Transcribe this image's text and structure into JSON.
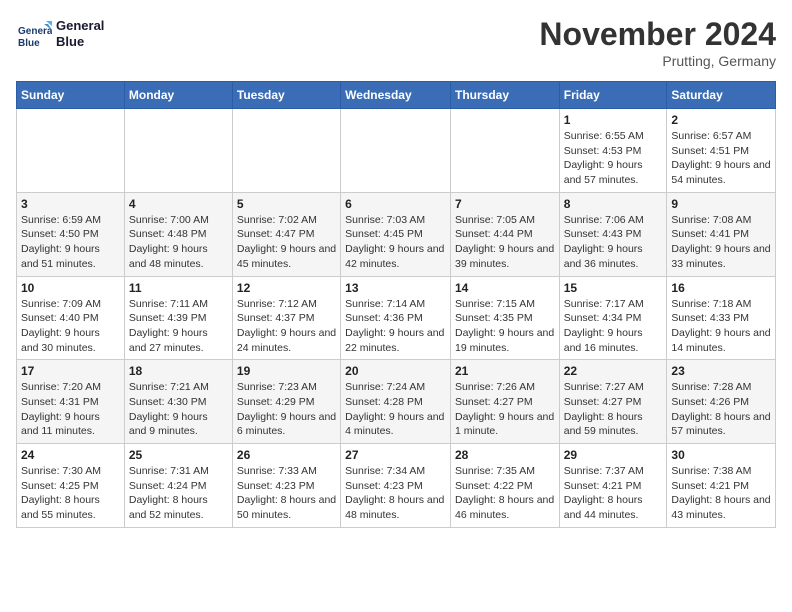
{
  "header": {
    "logo_line1": "General",
    "logo_line2": "Blue",
    "title": "November 2024",
    "subtitle": "Prutting, Germany"
  },
  "columns": [
    "Sunday",
    "Monday",
    "Tuesday",
    "Wednesday",
    "Thursday",
    "Friday",
    "Saturday"
  ],
  "weeks": [
    {
      "days": [
        {
          "num": "",
          "info": ""
        },
        {
          "num": "",
          "info": ""
        },
        {
          "num": "",
          "info": ""
        },
        {
          "num": "",
          "info": ""
        },
        {
          "num": "",
          "info": ""
        },
        {
          "num": "1",
          "info": "Sunrise: 6:55 AM\nSunset: 4:53 PM\nDaylight: 9 hours and 57 minutes."
        },
        {
          "num": "2",
          "info": "Sunrise: 6:57 AM\nSunset: 4:51 PM\nDaylight: 9 hours and 54 minutes."
        }
      ]
    },
    {
      "days": [
        {
          "num": "3",
          "info": "Sunrise: 6:59 AM\nSunset: 4:50 PM\nDaylight: 9 hours and 51 minutes."
        },
        {
          "num": "4",
          "info": "Sunrise: 7:00 AM\nSunset: 4:48 PM\nDaylight: 9 hours and 48 minutes."
        },
        {
          "num": "5",
          "info": "Sunrise: 7:02 AM\nSunset: 4:47 PM\nDaylight: 9 hours and 45 minutes."
        },
        {
          "num": "6",
          "info": "Sunrise: 7:03 AM\nSunset: 4:45 PM\nDaylight: 9 hours and 42 minutes."
        },
        {
          "num": "7",
          "info": "Sunrise: 7:05 AM\nSunset: 4:44 PM\nDaylight: 9 hours and 39 minutes."
        },
        {
          "num": "8",
          "info": "Sunrise: 7:06 AM\nSunset: 4:43 PM\nDaylight: 9 hours and 36 minutes."
        },
        {
          "num": "9",
          "info": "Sunrise: 7:08 AM\nSunset: 4:41 PM\nDaylight: 9 hours and 33 minutes."
        }
      ]
    },
    {
      "days": [
        {
          "num": "10",
          "info": "Sunrise: 7:09 AM\nSunset: 4:40 PM\nDaylight: 9 hours and 30 minutes."
        },
        {
          "num": "11",
          "info": "Sunrise: 7:11 AM\nSunset: 4:39 PM\nDaylight: 9 hours and 27 minutes."
        },
        {
          "num": "12",
          "info": "Sunrise: 7:12 AM\nSunset: 4:37 PM\nDaylight: 9 hours and 24 minutes."
        },
        {
          "num": "13",
          "info": "Sunrise: 7:14 AM\nSunset: 4:36 PM\nDaylight: 9 hours and 22 minutes."
        },
        {
          "num": "14",
          "info": "Sunrise: 7:15 AM\nSunset: 4:35 PM\nDaylight: 9 hours and 19 minutes."
        },
        {
          "num": "15",
          "info": "Sunrise: 7:17 AM\nSunset: 4:34 PM\nDaylight: 9 hours and 16 minutes."
        },
        {
          "num": "16",
          "info": "Sunrise: 7:18 AM\nSunset: 4:33 PM\nDaylight: 9 hours and 14 minutes."
        }
      ]
    },
    {
      "days": [
        {
          "num": "17",
          "info": "Sunrise: 7:20 AM\nSunset: 4:31 PM\nDaylight: 9 hours and 11 minutes."
        },
        {
          "num": "18",
          "info": "Sunrise: 7:21 AM\nSunset: 4:30 PM\nDaylight: 9 hours and 9 minutes."
        },
        {
          "num": "19",
          "info": "Sunrise: 7:23 AM\nSunset: 4:29 PM\nDaylight: 9 hours and 6 minutes."
        },
        {
          "num": "20",
          "info": "Sunrise: 7:24 AM\nSunset: 4:28 PM\nDaylight: 9 hours and 4 minutes."
        },
        {
          "num": "21",
          "info": "Sunrise: 7:26 AM\nSunset: 4:27 PM\nDaylight: 9 hours and 1 minute."
        },
        {
          "num": "22",
          "info": "Sunrise: 7:27 AM\nSunset: 4:27 PM\nDaylight: 8 hours and 59 minutes."
        },
        {
          "num": "23",
          "info": "Sunrise: 7:28 AM\nSunset: 4:26 PM\nDaylight: 8 hours and 57 minutes."
        }
      ]
    },
    {
      "days": [
        {
          "num": "24",
          "info": "Sunrise: 7:30 AM\nSunset: 4:25 PM\nDaylight: 8 hours and 55 minutes."
        },
        {
          "num": "25",
          "info": "Sunrise: 7:31 AM\nSunset: 4:24 PM\nDaylight: 8 hours and 52 minutes."
        },
        {
          "num": "26",
          "info": "Sunrise: 7:33 AM\nSunset: 4:23 PM\nDaylight: 8 hours and 50 minutes."
        },
        {
          "num": "27",
          "info": "Sunrise: 7:34 AM\nSunset: 4:23 PM\nDaylight: 8 hours and 48 minutes."
        },
        {
          "num": "28",
          "info": "Sunrise: 7:35 AM\nSunset: 4:22 PM\nDaylight: 8 hours and 46 minutes."
        },
        {
          "num": "29",
          "info": "Sunrise: 7:37 AM\nSunset: 4:21 PM\nDaylight: 8 hours and 44 minutes."
        },
        {
          "num": "30",
          "info": "Sunrise: 7:38 AM\nSunset: 4:21 PM\nDaylight: 8 hours and 43 minutes."
        }
      ]
    }
  ]
}
